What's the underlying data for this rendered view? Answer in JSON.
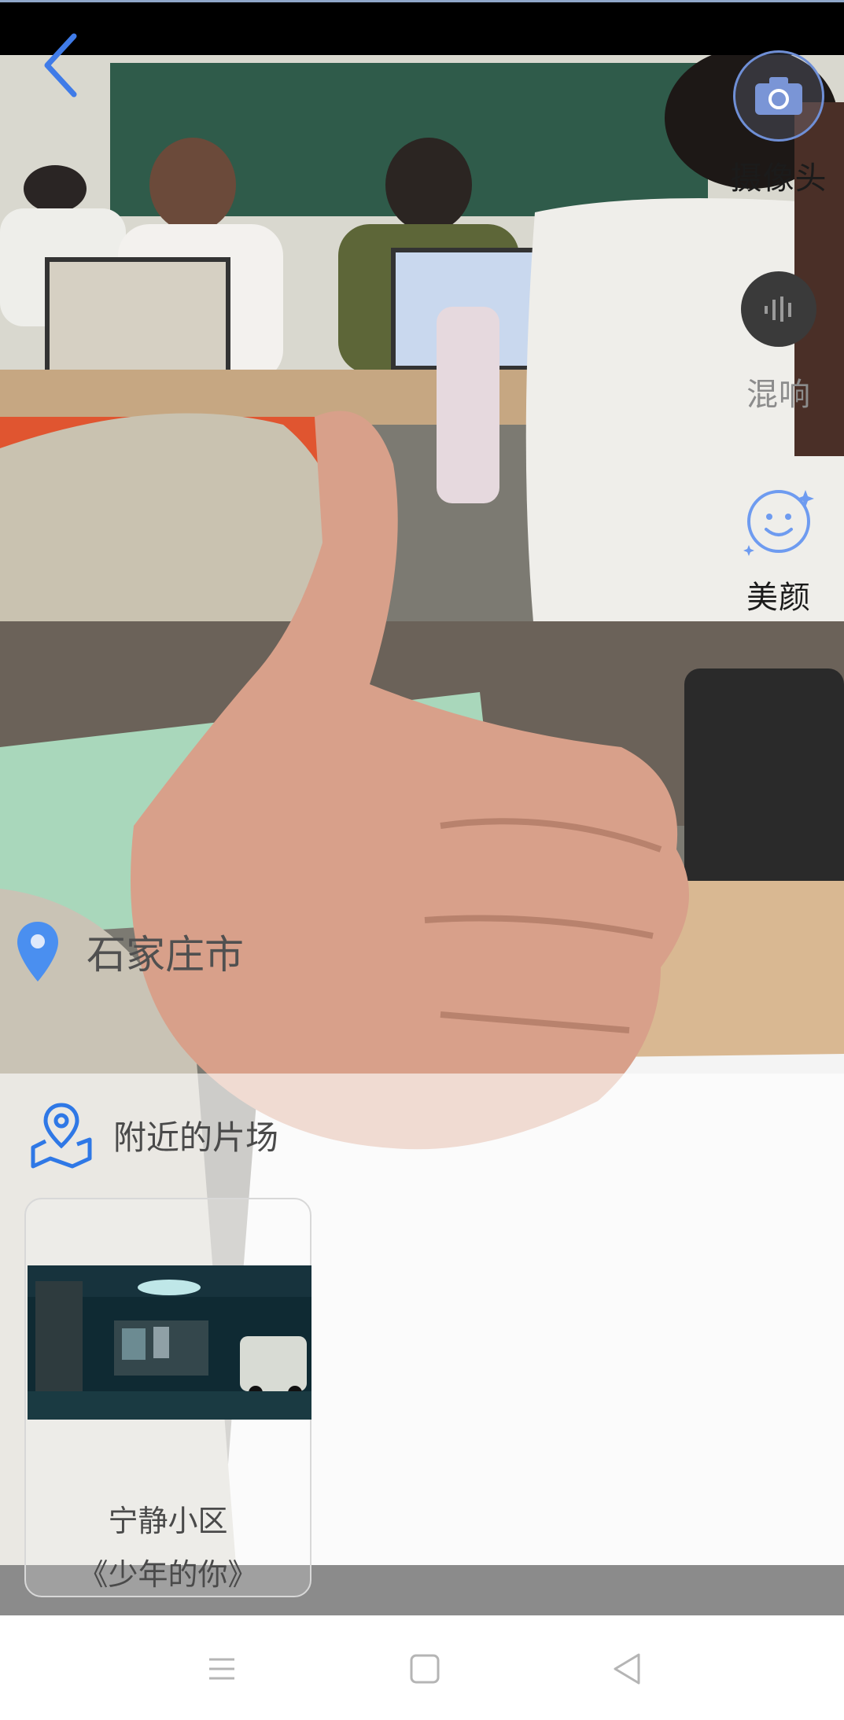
{
  "header": {
    "back_icon": "chevron-left-icon"
  },
  "controls": {
    "camera": {
      "label": "摄像头",
      "icon": "camera-switch-icon"
    },
    "reverb": {
      "label": "混响",
      "icon": "reverb-icon"
    },
    "beauty": {
      "label": "美颜",
      "icon": "smiley-icon"
    }
  },
  "location": {
    "icon": "location-pin-icon",
    "city": "石家庄市"
  },
  "nearby": {
    "icon": "map-pin-icon",
    "title": "附近的片场",
    "spots": [
      {
        "name": "宁静小区",
        "film": "《少年的你》"
      }
    ]
  },
  "navbar": {
    "icons": [
      "menu-icon",
      "home-square-icon",
      "back-triangle-icon"
    ]
  },
  "colors": {
    "accent_blue": "#3f7be8",
    "status_bar": "#000000",
    "band_gray": "#8b8b8b"
  }
}
